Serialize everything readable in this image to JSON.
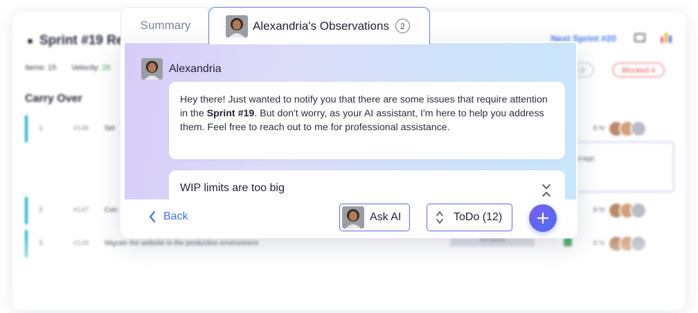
{
  "background": {
    "title": "Sprint #19 Re",
    "stats": {
      "items": "Items: 15",
      "velocity_label": "Velocity:",
      "velocity_value": "28"
    },
    "next_sprint": "Next Sprint #20",
    "pills": {
      "completed": "ted 0",
      "blocked": "Blocked 4"
    },
    "section": "Carry Over",
    "rows": [
      {
        "num": "1",
        "key": "#146",
        "text": "Set",
        "hours": "8 hr",
        "more": "+3"
      },
      {
        "num": "2",
        "key": "#147",
        "text": "Con",
        "hours": "8 hr",
        "more": "+2"
      },
      {
        "num": "3",
        "key": "#148",
        "text": "Migrate the website to the production environment",
        "hours": "8 hr",
        "more": "+2"
      }
    ],
    "detail_text": "torage.",
    "status_text": "Not Started"
  },
  "tabs": {
    "summary": "Summary",
    "observations": "Alexandria's Observations",
    "observations_count": "2"
  },
  "message": {
    "sender": "Alexandria",
    "text_before": "Hey there! Just wanted to notify you that there are some issues that require attention in the ",
    "text_bold": "Sprint #19",
    "text_after": ". But don't worry, as your AI assistant, I'm here to help you address them. Feel free to reach out to me for professional assistance."
  },
  "issue": {
    "title": "WIP limits are too big"
  },
  "footer": {
    "back": "Back",
    "ask_ai": "Ask AI",
    "todo": "ToDo (12)"
  },
  "colors": {
    "accent": "#3f6ef0",
    "button_border": "#5a63e6",
    "add_gradient_start": "#7c5cf2",
    "add_gradient_end": "#4a6ff0",
    "carry_bar": "#25b3c6",
    "blocked": "#e35c5c"
  },
  "icons": [
    "avatar-icon",
    "chevron-left-icon",
    "sort-arrows-icon",
    "plus-icon",
    "collapse-chevrons-icon",
    "window-icon",
    "chart-icon"
  ]
}
